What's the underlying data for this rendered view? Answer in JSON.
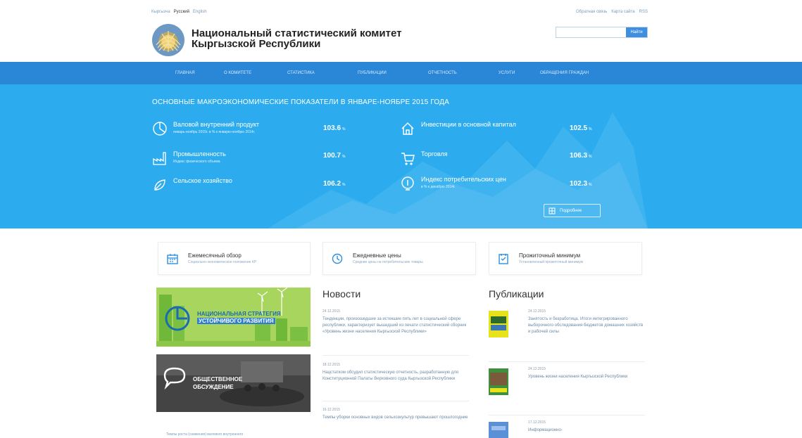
{
  "languages": [
    "Кыргызча",
    "Русский",
    "English"
  ],
  "top_links": [
    "Обратная связь",
    "Карта сайта",
    "RSS"
  ],
  "site_title": "Национальный статистический комитет Кыргызской Республики",
  "search": {
    "placeholder": "",
    "button": "Найти"
  },
  "nav": [
    "Главная",
    "О комитете",
    "Статистика",
    "Публикации",
    "Отчетность",
    "Услуги",
    "Обращения граждан"
  ],
  "hero": {
    "title": "Основные макроэкономические показатели в январе-ноябре 2015 года",
    "indicators": [
      {
        "name": "Валовой внутренний продукт",
        "sub": "январь-ноябрь 2015г. в % к январю-ноябрю 2014г.",
        "value": "103.6",
        "unit": "%",
        "icon": "pie-chart-icon"
      },
      {
        "name": "Инвестиции в основной капитал",
        "sub": "",
        "value": "102.5",
        "unit": "%",
        "icon": "house-icon"
      },
      {
        "name": "Промышленность",
        "sub": "Индекс физического объема",
        "value": "100.7",
        "unit": "%",
        "icon": "factory-icon"
      },
      {
        "name": "Торговля",
        "sub": "",
        "value": "106.3",
        "unit": "%",
        "icon": "cart-icon"
      },
      {
        "name": "Сельское хозяйство",
        "sub": "",
        "value": "106.2",
        "unit": "%",
        "icon": "leaf-icon"
      },
      {
        "name": "Индекс потребительских цен",
        "sub": "в % к декабрю 2014г.",
        "value": "102.3",
        "unit": "%",
        "icon": "price-index-icon"
      }
    ],
    "more": "Подробнее"
  },
  "cards": [
    {
      "title": "Ежемесячный обзор",
      "sub": "Социально-экономическое положение КР",
      "icon": "calendar-icon"
    },
    {
      "title": "Ежедневные цены",
      "sub": "Средние цены на потребительские товары",
      "icon": "clock-icon"
    },
    {
      "title": "Прожиточный минимум",
      "sub": "Установленный прожиточный минимум",
      "icon": "document-icon"
    }
  ],
  "banners": {
    "strategy_l1": "Национальная стратегия",
    "strategy_l2": "устойчивого развития",
    "discussion_l1": "Общественное",
    "discussion_l2": "обсуждение"
  },
  "left_link": "Темпы роста (снижения) валового внутреннего",
  "news": {
    "title": "Новости",
    "items": [
      {
        "date": "24.12.2015",
        "text": "Тенденции, произошедшие за истекшие пять лет в социальной сфере республики, характеризует вышедший из печати статистический сборник «Уровень жизни населения Кыргызской Республики»"
      },
      {
        "date": "18.12.2015",
        "text": "Нацстатком обсудил статистическую отчетность, разработанную для Конституционной Палаты Верховного суда Кыргызской Республики"
      },
      {
        "date": "16.12.2015",
        "text": "Темпы уборки основных видов сельхозкультур превышают прошлогодние"
      }
    ]
  },
  "publications": {
    "title": "Публикации",
    "items": [
      {
        "date": "24.12.2015",
        "text": "Занятость и безработица. Итоги интегрированного выборочного обследования бюджетов домашних хозяйств и рабочей силы"
      },
      {
        "date": "24.12.2015",
        "text": "Уровень жизни населения Кыргызской Республики"
      },
      {
        "date": "17.12.2015",
        "text": "Информационно-"
      }
    ]
  }
}
